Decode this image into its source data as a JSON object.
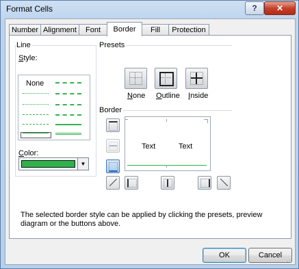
{
  "window": {
    "title": "Format Cells",
    "help_label": "?",
    "close_label": "✕"
  },
  "tabs": [
    "Number",
    "Alignment",
    "Font",
    "Border",
    "Fill",
    "Protection"
  ],
  "active_tab": "Border",
  "line": {
    "group_label": "Line",
    "style_label": "Style:",
    "none_label": "None",
    "color_label": "Color:",
    "color_value": "#2db34a"
  },
  "presets": {
    "group_label": "Presets",
    "items": [
      {
        "label": "None",
        "icon": "preset-none-icon"
      },
      {
        "label": "Outline",
        "icon": "preset-outline-icon"
      },
      {
        "label": "Inside",
        "icon": "preset-inside-icon"
      }
    ]
  },
  "border": {
    "group_label": "Border",
    "preview_text_1": "Text",
    "preview_text_2": "Text",
    "buttons": [
      "border-top-icon",
      "border-middle-horizontal-icon",
      "border-bottom-icon",
      "border-diagonal-up-icon",
      "border-left-icon",
      "border-middle-vertical-icon",
      "border-right-icon",
      "border-diagonal-down-icon"
    ],
    "active_border": "bottom",
    "active_border_color": "#2db34a"
  },
  "description": "The selected border style can be applied by clicking the presets, preview diagram or the buttons above.",
  "buttons": {
    "ok": "OK",
    "cancel": "Cancel"
  }
}
